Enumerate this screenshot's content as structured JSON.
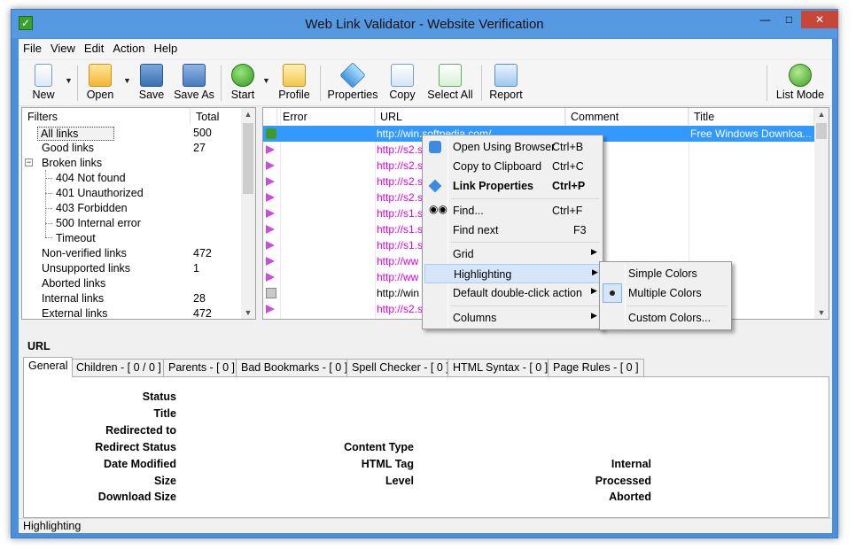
{
  "window": {
    "title": "Web Link Validator - Website Verification"
  },
  "menubar": [
    "File",
    "View",
    "Edit",
    "Action",
    "Help"
  ],
  "toolbar": {
    "new": "New",
    "open": "Open",
    "save": "Save",
    "save_as": "Save As",
    "start": "Start",
    "profile": "Profile",
    "properties": "Properties",
    "copy": "Copy",
    "select_all": "Select All",
    "report": "Report",
    "list_mode": "List Mode"
  },
  "filters": {
    "headers": {
      "name": "Filters",
      "total": "Total"
    },
    "rows": [
      {
        "name": "All links",
        "count": "500"
      },
      {
        "name": "Good links",
        "count": "27"
      },
      {
        "name": "Broken links",
        "count": ""
      },
      {
        "name": "404 Not found",
        "count": ""
      },
      {
        "name": "401 Unauthorized",
        "count": ""
      },
      {
        "name": "403 Forbidden",
        "count": ""
      },
      {
        "name": "500 Internal error",
        "count": ""
      },
      {
        "name": "Timeout",
        "count": ""
      },
      {
        "name": "Non-verified links",
        "count": "472"
      },
      {
        "name": "Unsupported links",
        "count": "1"
      },
      {
        "name": "Aborted links",
        "count": ""
      },
      {
        "name": "Internal links",
        "count": "28"
      },
      {
        "name": "External links",
        "count": "472"
      }
    ]
  },
  "links": {
    "headers": {
      "error": "Error",
      "url": "URL",
      "comment": "Comment",
      "title": "Title"
    },
    "rows": [
      {
        "url": "http://win.softpedia.com/",
        "title": "Free Windows Downloa..."
      },
      {
        "url": "http://s2.s",
        "title": ""
      },
      {
        "url": "http://s2.s",
        "title": ""
      },
      {
        "url": "http://s2.s",
        "title": ""
      },
      {
        "url": "http://s2.s",
        "title": ""
      },
      {
        "url": "http://s1.s",
        "title": ""
      },
      {
        "url": "http://s1.s",
        "title": ""
      },
      {
        "url": "http://s1.s",
        "title": ""
      },
      {
        "url": "http://ww",
        "title": ""
      },
      {
        "url": "http://ww",
        "title": ""
      },
      {
        "url": "http://win",
        "title": ""
      },
      {
        "url": "http://s2.s",
        "title": ""
      }
    ]
  },
  "context_menu": {
    "items": [
      {
        "label": "Open Using Browser",
        "key": "Ctrl+B"
      },
      {
        "label": "Copy to Clipboard",
        "key": "Ctrl+C"
      },
      {
        "label": "Link Properties",
        "key": "Ctrl+P"
      },
      {
        "label": "Find...",
        "key": "Ctrl+F"
      },
      {
        "label": "Find next",
        "key": "F3"
      },
      {
        "label": "Grid",
        "key": ""
      },
      {
        "label": "Highlighting",
        "key": ""
      },
      {
        "label": "Default double-click action",
        "key": ""
      },
      {
        "label": "Columns",
        "key": ""
      }
    ]
  },
  "highlight_submenu": {
    "items": [
      {
        "label": "Simple Colors"
      },
      {
        "label": "Multiple Colors"
      },
      {
        "label": "Custom Colors..."
      }
    ],
    "selected": "Multiple Colors"
  },
  "details": {
    "section_label": "URL",
    "tabs": [
      "General",
      "Children - [ 0 / 0 ]",
      "Parents - [ 0 ]",
      "Bad Bookmarks - [ 0 ]",
      "Spell Checker - [ 0 ]",
      "HTML Syntax - [ 0 ]",
      "Page Rules - [ 0 ]"
    ],
    "col1": [
      "Status",
      "Title",
      "Redirected to",
      "Redirect Status",
      "Date Modified",
      "Size",
      "Download Size"
    ],
    "col2": [
      "Content Type",
      "HTML Tag",
      "Level"
    ],
    "col3": [
      "Internal",
      "Processed",
      "Aborted"
    ]
  },
  "statusbar": {
    "text": "Highlighting"
  }
}
